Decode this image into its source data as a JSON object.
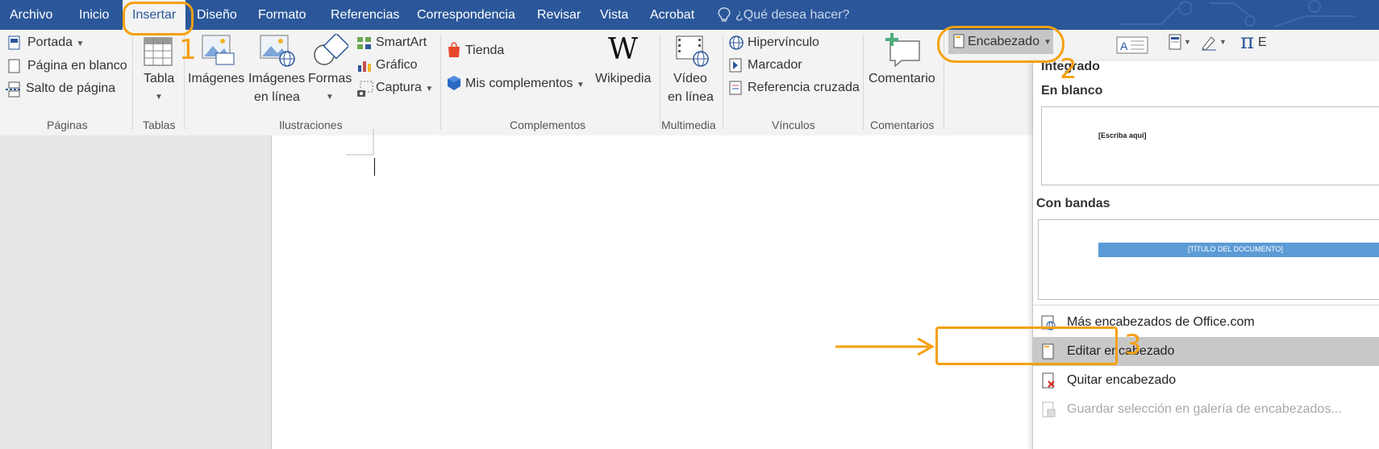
{
  "tabs": [
    {
      "label": "Archivo"
    },
    {
      "label": "Inicio"
    },
    {
      "label": "Insertar"
    },
    {
      "label": "Diseño"
    },
    {
      "label": "Formato"
    },
    {
      "label": "Referencias"
    },
    {
      "label": "Correspondencia"
    },
    {
      "label": "Revisar"
    },
    {
      "label": "Vista"
    },
    {
      "label": "Acrobat"
    }
  ],
  "active_tab": "Insertar",
  "tell_me": "¿Qué desea hacer?",
  "groups": {
    "paginas": {
      "label": "Páginas",
      "portada": "Portada",
      "pagina_en_blanco": "Página en blanco",
      "salto": "Salto de página"
    },
    "tablas": {
      "label": "Tablas",
      "tabla": "Tabla"
    },
    "ilustraciones": {
      "label": "Ilustraciones",
      "imagenes": "Imágenes",
      "imagenes_linea_1": "Imágenes",
      "imagenes_linea_2": "en línea",
      "formas": "Formas",
      "smartart": "SmartArt",
      "grafico": "Gráfico",
      "captura": "Captura"
    },
    "complementos": {
      "label": "Complementos",
      "tienda": "Tienda",
      "mis": "Mis complementos",
      "wikipedia": "Wikipedia",
      "w_glyph": "W"
    },
    "multimedia": {
      "label": "Multimedia",
      "video_1": "Vídeo",
      "video_2": "en línea"
    },
    "vinculos": {
      "label": "Vínculos",
      "hipervinculo": "Hipervínculo",
      "marcador": "Marcador",
      "referencia": "Referencia cruzada"
    },
    "comentarios": {
      "label": "Comentarios",
      "comentario": "Comentario"
    },
    "encabezado": {
      "label": "Encabezado"
    },
    "extra": {
      "pi": "π",
      "e": "E"
    }
  },
  "dropdown": {
    "section": "Integrado",
    "blank_heading": "En blanco",
    "blank_placeholder": "[Escriba aquí]",
    "banded_heading": "Con bandas",
    "banded_title": "[TÍTULO DEL DOCUMENTO]",
    "items": [
      {
        "label": "Más encabezados de Office.com",
        "state": "normal"
      },
      {
        "label": "Editar encabezado",
        "state": "hover"
      },
      {
        "label": "Quitar encabezado",
        "state": "normal"
      },
      {
        "label": "Guardar selección en galería de encabezados...",
        "state": "disabled"
      }
    ]
  },
  "annotations": {
    "n1": "1",
    "n2": "2",
    "n3": "3"
  },
  "colors": {
    "title_bar": "#2b579a",
    "annotation": "#f5a00f",
    "banded_bar": "#5b9bd5"
  }
}
